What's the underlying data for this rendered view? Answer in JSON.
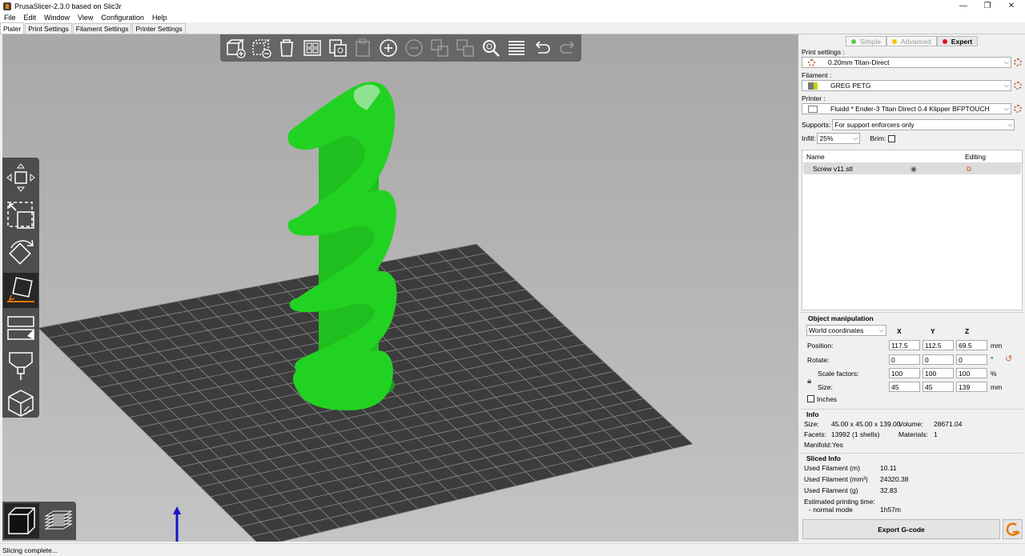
{
  "window": {
    "title": "PrusaSlicer-2.3.0 based on Slic3r",
    "controls": [
      "—",
      "❐",
      "✕"
    ]
  },
  "menu": [
    "File",
    "Edit",
    "Window",
    "View",
    "Configuration",
    "Help"
  ],
  "tabs": [
    {
      "label": "Plater",
      "active": true
    },
    {
      "label": "Print Settings",
      "active": false
    },
    {
      "label": "Filament Settings",
      "active": false
    },
    {
      "label": "Printer Settings",
      "active": false
    }
  ],
  "toolbar_icons": [
    "add-icon",
    "delete-icon",
    "delete-all-icon",
    "arrange-icon",
    "copy-icon",
    "paste-icon",
    "add-instance-icon",
    "remove-instance-icon",
    "split-objects-icon",
    "split-parts-icon",
    "search-icon",
    "layers-icon",
    "undo-icon",
    "redo-icon"
  ],
  "gizmo_icons": [
    "move-icon",
    "scale-icon",
    "rotate-icon",
    "place-on-face-icon",
    "cut-icon",
    "paint-supports-icon",
    "seam-icon"
  ],
  "view_toggle_icons": [
    "3d-view-icon",
    "preview-icon"
  ],
  "modes": [
    {
      "label": "Simple",
      "color": "#5fc94a",
      "active": false
    },
    {
      "label": "Advanced",
      "color": "#f2c200",
      "active": false
    },
    {
      "label": "Expert",
      "color": "#d9141e",
      "active": true
    }
  ],
  "print_settings": {
    "label": "Print settings :",
    "value": "0.20mm Titan-Direct"
  },
  "filament": {
    "label": "Filament :",
    "value": "GREG PETG",
    "color": "#7ab317"
  },
  "printer": {
    "label": "Printer :",
    "value": "Fluidd * Ender-3 Titan Direct 0.4 Klipper BFPTOUCH"
  },
  "supports": {
    "label": "Supports:",
    "value": "For support enforcers only"
  },
  "infill": {
    "label": "Infill:",
    "value": "25%"
  },
  "brim": {
    "label": "Brim:",
    "checked": false
  },
  "object_list": {
    "col_name": "Name",
    "col_editing": "Editing",
    "rows": [
      {
        "name": "Screw v11.stl"
      }
    ]
  },
  "object_manipulation": {
    "title": "Object manipulation",
    "coords": "World coordinates",
    "axes": [
      "X",
      "Y",
      "Z"
    ],
    "position_label": "Position:",
    "position": [
      "117.5",
      "112.5",
      "69.5"
    ],
    "position_unit": "mm",
    "rotate_label": "Rotate:",
    "rotate": [
      "0",
      "0",
      "0"
    ],
    "rotate_unit": "°",
    "scale_label": "Scale factors:",
    "scale": [
      "100",
      "100",
      "100"
    ],
    "scale_unit": "%",
    "size_label": "Size:",
    "size": [
      "45",
      "45",
      "139"
    ],
    "size_unit": "mm",
    "inches_label": "Inches"
  },
  "info": {
    "title": "Info",
    "size_label": "Size:",
    "size": "45.00 x 45.00 x 139.00",
    "volume_label": "Volume:",
    "volume": "28671.04",
    "facets_label": "Facets:",
    "facets": "13992 (1 shells)",
    "materials_label": "Materials:",
    "materials": "1",
    "manifold_label": "Manifold:",
    "manifold": "Yes"
  },
  "sliced_info": {
    "title": "Sliced Info",
    "rows": [
      {
        "label": "Used Filament (m)",
        "value": "10.11"
      },
      {
        "label": "Used Filament (mm³)",
        "value": "24320.38"
      },
      {
        "label": "Used Filament (g)",
        "value": "32.83"
      }
    ],
    "time_label": "Estimated printing time:",
    "mode_label": "- normal mode",
    "mode_value": "1h57m"
  },
  "export_label": "Export G-code",
  "status": "Slicing complete..."
}
